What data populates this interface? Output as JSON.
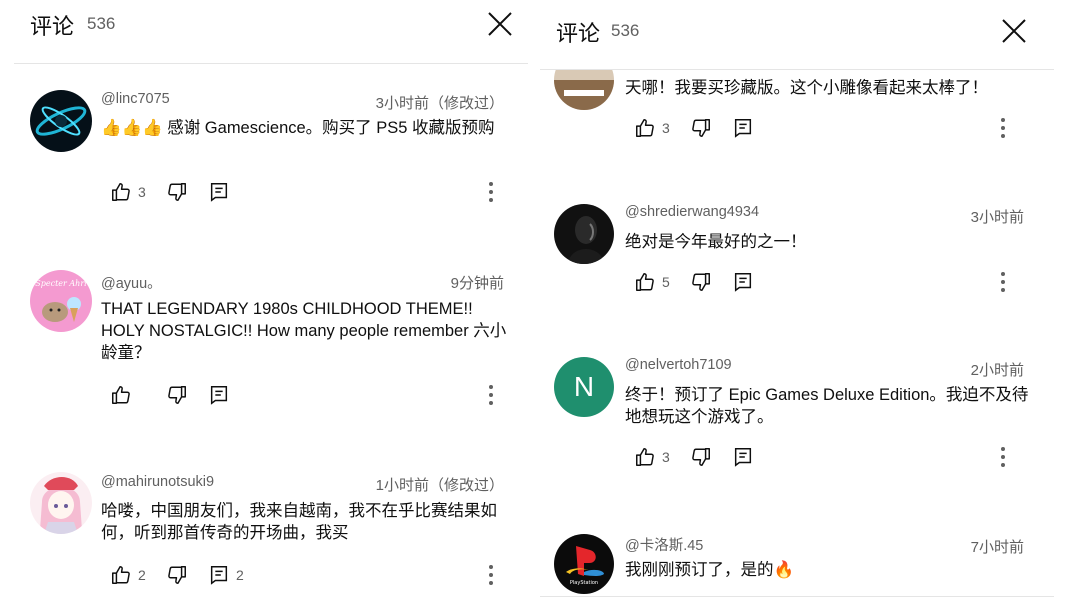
{
  "left": {
    "title": "评论",
    "count": "536",
    "comments": [
      {
        "author": "@linc7075",
        "time": "3小时前（修改过）",
        "text": "👍👍👍 感谢 Gamescience。购买了 PS5 收藏版预购",
        "likes": "3",
        "replies": ""
      },
      {
        "author": "@ayuu。",
        "time": "9分钟前",
        "text": "THAT LEGENDARY 1980s CHILDHOOD THEME!! HOLY NOSTALGIC!! How many people remember 六小龄童？",
        "likes": "",
        "replies": ""
      },
      {
        "author": "@mahirunotsuki9",
        "time": "1小时前（修改过）",
        "text": "哈喽，中国朋友们，我来自越南，我不在乎比赛结果如何，听到那首传奇的开场曲，我买",
        "likes": "2",
        "replies": "2"
      }
    ]
  },
  "right": {
    "title": "评论",
    "count": "536",
    "comments": [
      {
        "author": "",
        "time": "",
        "text": "天哪！我要买珍藏版。这个小雕像看起来太棒了！",
        "likes": "3",
        "replies": ""
      },
      {
        "author": "@shredierwang4934",
        "time": "3小时前",
        "text": "绝对是今年最好的之一！",
        "likes": "5",
        "replies": ""
      },
      {
        "author": "@nelvertoh7109",
        "time": "2小时前",
        "text": "终于！预订了 Epic Games Deluxe Edition。我迫不及待地想玩这个游戏了。",
        "likes": "3",
        "replies": "",
        "avatar_letter": "N"
      },
      {
        "author": "@卡洛斯.45",
        "time": "7小时前",
        "text": "我刚刚预订了，是的🔥",
        "likes": "",
        "replies": "",
        "avatar_text": "PlayStation"
      }
    ]
  },
  "colors": {
    "text": "#0f0f0f",
    "secondary": "#606060",
    "divider": "#e5e5e5",
    "avatar_green": "#1f8f6e"
  }
}
